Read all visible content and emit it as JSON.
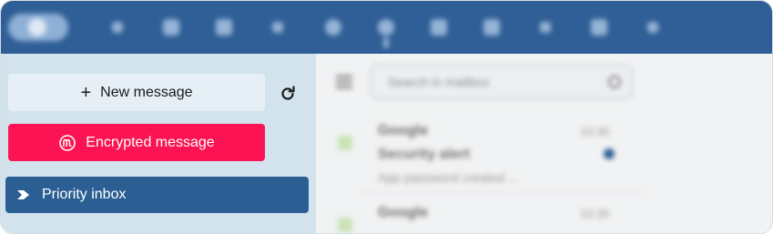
{
  "sidebar": {
    "new_message_label": "New message",
    "new_message_icon": "plus-icon",
    "refresh_icon": "refresh-icon",
    "encrypted_message_label": "Encrypted message",
    "encrypted_message_icon": "encryption-m-icon",
    "priority_inbox_label": "Priority inbox",
    "priority_inbox_icon": "chevron-right-icon"
  },
  "toolbar": {
    "icons": [
      "mail-icon",
      "video-icon",
      "contacts-icon",
      "pin-icon",
      "clock-icon",
      "tips-icon",
      "notifications-icon",
      "calendar-icon",
      "edit-icon",
      "cloud-icon",
      "check-icon"
    ]
  },
  "main": {
    "search_placeholder": "Search in mailbox",
    "messages": [
      {
        "sender": "Google",
        "subject": "Security alert",
        "preview": "App password created ...",
        "time": "10:30",
        "unread": true
      },
      {
        "sender": "Google",
        "subject": "",
        "preview": "",
        "time": "10:30",
        "unread": false
      }
    ]
  },
  "colors": {
    "topbar": "#2f5f96",
    "sidebar": "#d3e3ee",
    "encrypted_button": "#fb1353",
    "priority_active": "#2b5f94"
  }
}
